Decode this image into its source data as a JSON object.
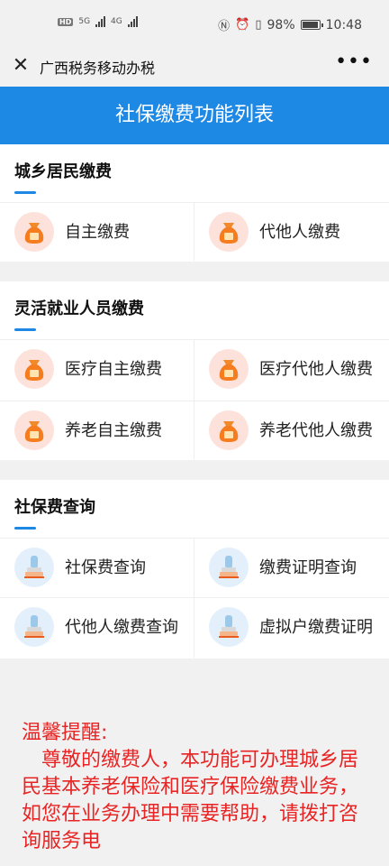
{
  "status_bar": {
    "network_badge": "HD",
    "sim1": "5G",
    "sim2": "4G",
    "battery": "98%",
    "time": "10:48"
  },
  "nav": {
    "title": "广西税务移动办税",
    "more": "•••"
  },
  "header": {
    "title": "社保缴费功能列表"
  },
  "sections": [
    {
      "title": "城乡居民缴费",
      "items": [
        {
          "label": "自主缴费",
          "icon": "money-bag-icon"
        },
        {
          "label": "代他人缴费",
          "icon": "money-bag-icon"
        }
      ]
    },
    {
      "title": "灵活就业人员缴费",
      "items": [
        {
          "label": "医疗自主缴费",
          "icon": "money-bag-icon"
        },
        {
          "label": "医疗代他人缴费",
          "icon": "money-bag-icon"
        },
        {
          "label": "养老自主缴费",
          "icon": "money-bag-icon"
        },
        {
          "label": "养老代他人缴费",
          "icon": "money-bag-icon"
        }
      ]
    },
    {
      "title": "社保费查询",
      "items": [
        {
          "label": "社保费查询",
          "icon": "stamp-icon"
        },
        {
          "label": "缴费证明查询",
          "icon": "stamp-icon"
        },
        {
          "label": "代他人缴费查询",
          "icon": "stamp-icon"
        },
        {
          "label": "虚拟户缴费证明",
          "icon": "stamp-icon"
        }
      ]
    }
  ],
  "reminder": {
    "title": "温馨提醒:",
    "body": "尊敬的缴费人，本功能可办理城乡居民基本养老保险和医疗保险缴费业务，如您在业务办理中需要帮助，请拨打咨询服务电"
  },
  "colors": {
    "accent": "#1e88e5",
    "bag_orange": "#f57c1f",
    "reminder_red": "#e82424"
  }
}
